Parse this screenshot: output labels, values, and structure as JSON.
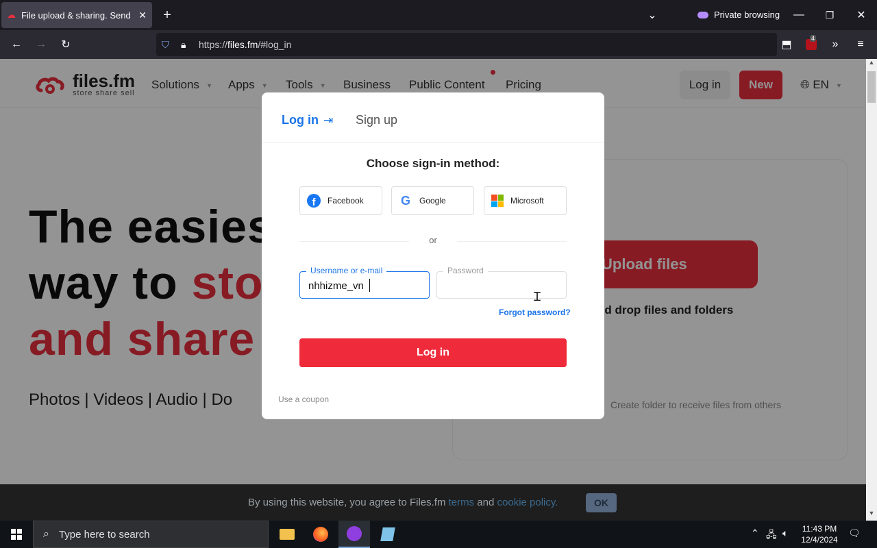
{
  "browser": {
    "tab_title": "File upload & sharing. Send lar",
    "private_label": "Private browsing",
    "url_prefix": "https://",
    "url_host": "files.fm",
    "url_path": "/#log_in",
    "extension_badge": "4"
  },
  "site": {
    "logo_name": "files.fm",
    "logo_tagline": "store share sell",
    "nav": [
      "Solutions",
      "Apps",
      "Tools",
      "Business",
      "Public Content",
      "Pricing"
    ],
    "login_label": "Log in",
    "new_label": "New",
    "lang_label": "EN",
    "hero": {
      "line1": "The easies",
      "line2_a": "way to ",
      "line2_b": "sto",
      "line3": "and share",
      "sub": "Photos  |  Videos  |  Audio  |  Do"
    },
    "upload_label": "Upload files",
    "drop_text": "nd drop files and folders",
    "create_folder": "Create folder to receive files from others"
  },
  "modal": {
    "tab_login": "Log in",
    "tab_signup": "Sign up",
    "title": "Choose sign-in method:",
    "social": {
      "facebook": "Facebook",
      "google": "Google",
      "microsoft": "Microsoft"
    },
    "or": "or",
    "username_label": "Username or e-mail",
    "username_value": "nhhizme_vn",
    "password_label": "Password",
    "forgot": "Forgot password?",
    "login_button": "Log in",
    "coupon": "Use a coupon"
  },
  "cookie": {
    "text_a": "By using this website, you agree to Files.fm ",
    "terms": "terms",
    "and": " and ",
    "policy": "cookie policy.",
    "ok": "OK"
  },
  "taskbar": {
    "search_placeholder": "Type here to search",
    "time": "11:43 PM",
    "date": "12/4/2024"
  },
  "colors": {
    "brand_red": "#e8303f",
    "link_blue": "#1a73e8"
  }
}
